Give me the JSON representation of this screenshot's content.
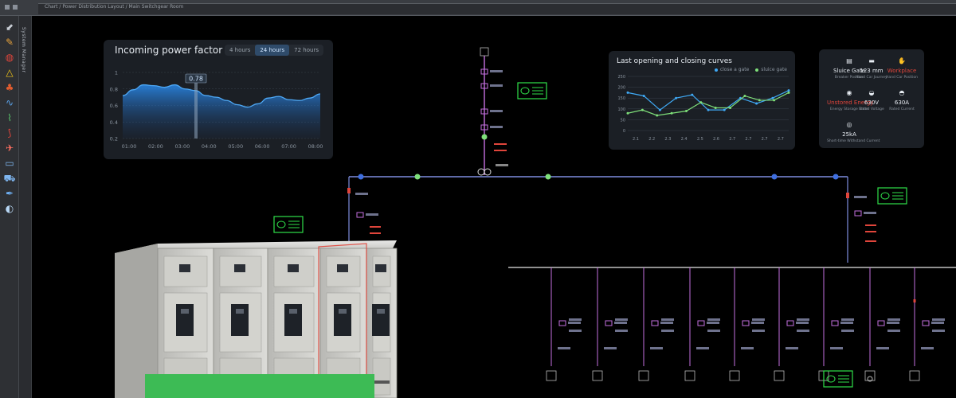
{
  "window": {
    "title": "Chart / Power Distribution Layout / Main Switchgear Room"
  },
  "left_toolbar": {
    "tools": [
      {
        "name": "selector-icon",
        "glyph": "⬋",
        "color": "#c9ced5"
      },
      {
        "name": "brush-icon",
        "glyph": "✎",
        "color": "#e6a23c"
      },
      {
        "name": "shapes-icon",
        "glyph": "◍",
        "color": "#e0453b"
      },
      {
        "name": "triangle-icon",
        "glyph": "△",
        "color": "#f0c419"
      },
      {
        "name": "tree-icon",
        "glyph": "♣",
        "color": "#e35d2f"
      },
      {
        "name": "wave-icon",
        "glyph": "∿",
        "color": "#5aa0e6"
      },
      {
        "name": "pulse-icon",
        "glyph": "⌇",
        "color": "#59c46b"
      },
      {
        "name": "hook-icon",
        "glyph": "⟆",
        "color": "#e0453b"
      },
      {
        "name": "plane-icon",
        "glyph": "✈",
        "color": "#ff6f61"
      },
      {
        "name": "battery-icon",
        "glyph": "▭",
        "color": "#7fb6f0"
      },
      {
        "name": "car-icon",
        "glyph": "⛟",
        "color": "#7fb6f0"
      },
      {
        "name": "pen-icon",
        "glyph": "✒",
        "color": "#6fb1f5"
      },
      {
        "name": "sim-icon",
        "glyph": "◐",
        "color": "#b8d7f5"
      }
    ],
    "side_tab_label": "System Manager"
  },
  "power_factor": {
    "title": "Incoming power factor",
    "ranges": [
      "4 hours",
      "24 hours",
      "72 hours"
    ],
    "selected_range": "24 hours",
    "cursor_value": "0.78",
    "colors": {
      "line": "#4ea8f5",
      "cursor": "#8fa6be"
    },
    "chart_data": {
      "type": "area",
      "x": [
        "01:00",
        "02:00",
        "03:00",
        "04:00",
        "05:00",
        "06:00",
        "07:00",
        "08:00"
      ],
      "y_ticks": [
        "0.2",
        "0.4",
        "0.6",
        "0.8",
        "1"
      ],
      "ylim": [
        0.2,
        1.0
      ],
      "series": [
        {
          "values": [
            0.72,
            0.79,
            0.85,
            0.84,
            0.82,
            0.85,
            0.8,
            0.78,
            0.72,
            0.7,
            0.66,
            0.61,
            0.58,
            0.62,
            0.69,
            0.71,
            0.67,
            0.66,
            0.69,
            0.74
          ]
        }
      ]
    }
  },
  "curves": {
    "title": "Last opening and closing curves",
    "legend": [
      {
        "label": "close a gate",
        "color": "#3fa9f5"
      },
      {
        "label": "sluice gate",
        "color": "#7fe07a"
      }
    ],
    "chart_data": {
      "type": "line",
      "categories": [
        "2.1",
        "2.2",
        "2.3",
        "2.4",
        "2.5",
        "2.6",
        "2.7",
        "2.7",
        "2.7",
        "2.7"
      ],
      "y_ticks": [
        "0",
        "50",
        "100",
        "150",
        "200",
        "250"
      ],
      "ylim": [
        0,
        250
      ],
      "series": [
        {
          "name": "close a gate",
          "values": [
            175,
            160,
            95,
            150,
            165,
            95,
            95,
            150,
            125,
            150,
            185
          ]
        },
        {
          "name": "sluice gate",
          "values": [
            80,
            95,
            70,
            80,
            90,
            130,
            105,
            105,
            160,
            140,
            140,
            175
          ]
        }
      ]
    }
  },
  "status": {
    "items": [
      {
        "icon": "clipboard-icon",
        "glyph": "▤",
        "value": "Sluice Gate",
        "sub": "Breaker Position",
        "warn": false
      },
      {
        "icon": "ruler-icon",
        "glyph": "▬",
        "value": "123 mm",
        "sub": "Hand Car Journey",
        "warn": false
      },
      {
        "icon": "hand-icon",
        "glyph": "✋",
        "value": "Workplace",
        "sub": "Hand Car Position",
        "warn": true
      },
      {
        "icon": "energy-icon",
        "glyph": "◉",
        "value": "Unstored Energy",
        "sub": "Energy Storage State",
        "warn": true
      },
      {
        "icon": "voltage-icon",
        "glyph": "◒",
        "value": "630V",
        "sub": "Rated Voltage",
        "warn": false
      },
      {
        "icon": "current-icon",
        "glyph": "◓",
        "value": "630A",
        "sub": "Rated Current",
        "warn": false
      },
      {
        "icon": "shield-icon",
        "glyph": "◎",
        "value": "25kA",
        "sub": "Short-time Withstand Current",
        "warn": false
      }
    ]
  },
  "diagram": {
    "colors": {
      "bus": "#7f8ee0",
      "branch": "#c56fe0",
      "node_blue": "#3f6fe0",
      "node_green": "#7fe07a",
      "tag_red": "#e0453b",
      "monitor": "#2fe04a",
      "white_bus": "#e6e6e6"
    }
  }
}
